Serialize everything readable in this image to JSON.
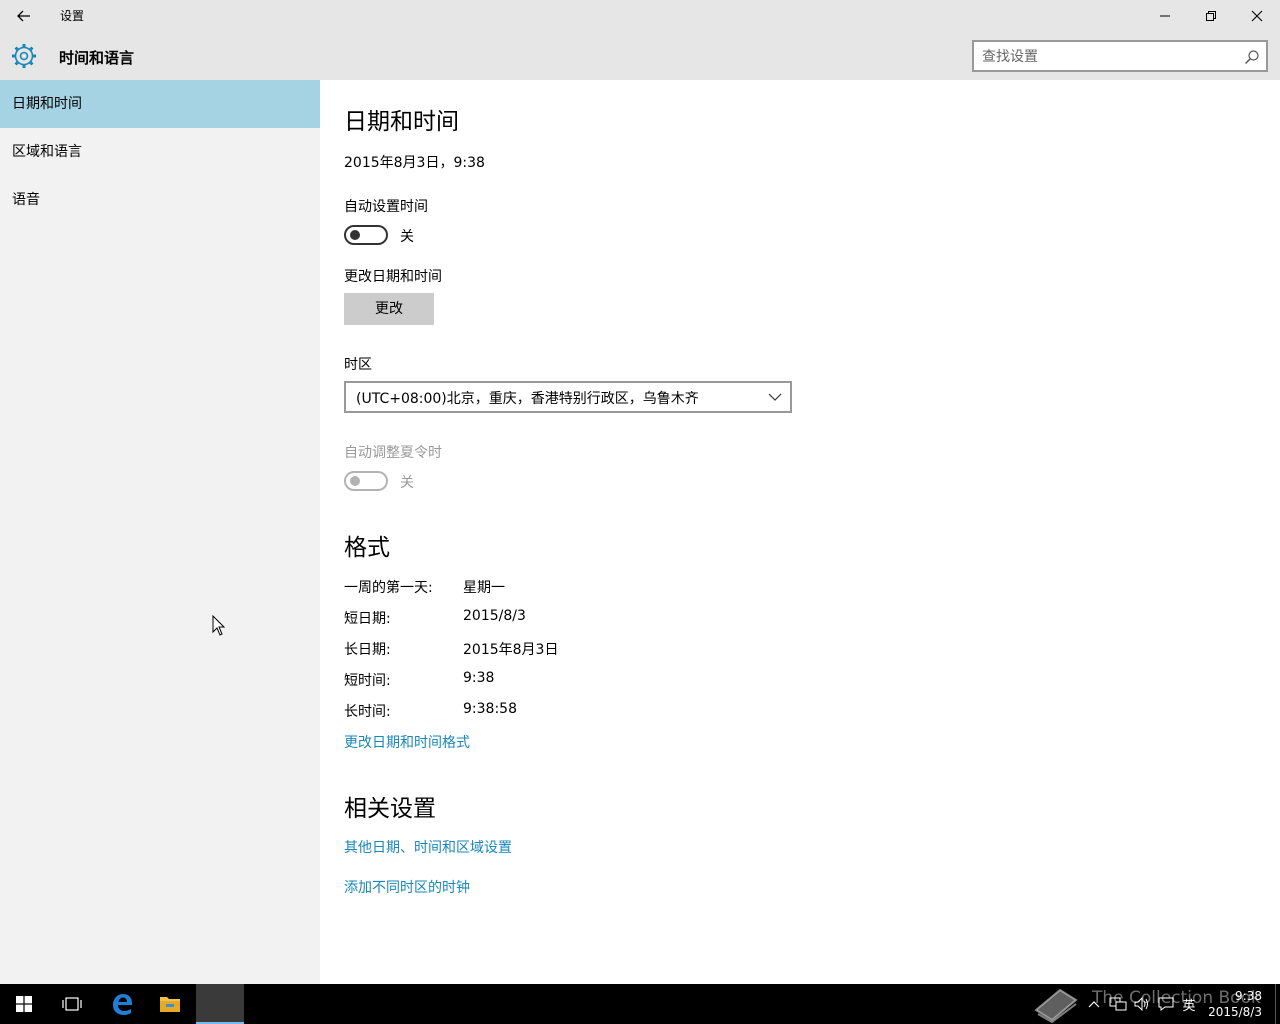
{
  "window": {
    "title": "设置"
  },
  "header": {
    "title": "时间和语言"
  },
  "search": {
    "placeholder": "查找设置"
  },
  "sidebar": {
    "items": [
      {
        "label": "日期和时间",
        "active": true
      },
      {
        "label": "区域和语言",
        "active": false
      },
      {
        "label": "语音",
        "active": false
      }
    ]
  },
  "datetime": {
    "heading": "日期和时间",
    "current": "2015年8月3日，9:38",
    "auto_time_label": "自动设置时间",
    "auto_time_state": "关",
    "change_label": "更改日期和时间",
    "change_button": "更改",
    "timezone_label": "时区",
    "timezone_value": "(UTC+08:00)北京，重庆，香港特别行政区，乌鲁木齐",
    "dst_label": "自动调整夏令时",
    "dst_state": "关"
  },
  "format": {
    "heading": "格式",
    "rows": [
      {
        "key": "一周的第一天:",
        "value": "星期一"
      },
      {
        "key": "短日期:",
        "value": "2015/8/3"
      },
      {
        "key": "长日期:",
        "value": "2015年8月3日"
      },
      {
        "key": "短时间:",
        "value": "9:38"
      },
      {
        "key": "长时间:",
        "value": "9:38:58"
      }
    ],
    "change_link": "更改日期和时间格式"
  },
  "related": {
    "heading": "相关设置",
    "link1": "其他日期、时间和区域设置",
    "link2": "添加不同时区的时钟"
  },
  "taskbar": {
    "time": "9:38",
    "date": "2015/8/3",
    "ime": "英",
    "watermark": "The Collection Book"
  },
  "colors": {
    "accent": "#1a87b8",
    "sidebar_selected": "#a6d3e3",
    "titlebar": "#e6e6e6",
    "sidebar": "#f2f2f2"
  }
}
